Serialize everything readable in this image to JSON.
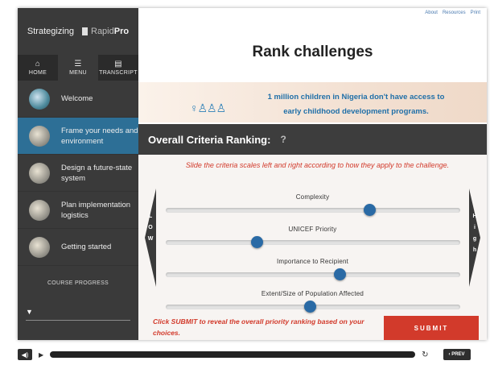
{
  "brand": {
    "text": "Strategizing",
    "rapid": "Rapid",
    "pro": "Pro"
  },
  "nav": [
    {
      "icon": "home-icon",
      "glyph": "⌂",
      "label": "HOME"
    },
    {
      "icon": "menu-icon",
      "glyph": "☰",
      "label": "MENU"
    },
    {
      "icon": "transcript-icon",
      "glyph": "▤",
      "label": "TRANSCRIPT"
    }
  ],
  "menu": [
    {
      "label": "Welcome",
      "active": false
    },
    {
      "label": "Frame your needs and environment",
      "active": true
    },
    {
      "label": "Design a future-state system",
      "active": false
    },
    {
      "label": "Plan implementation logistics",
      "active": false
    },
    {
      "label": "Getting started",
      "active": false
    }
  ],
  "course_progress": {
    "label": "COURSE PROGRESS",
    "glyph": "▼"
  },
  "toplinks": [
    "About",
    "Resources",
    "Print"
  ],
  "page_title": "Rank challenges",
  "banner": {
    "line1": "1 million children in Nigeria don't have access to",
    "line2": "early childhood development programs."
  },
  "section": {
    "title": "Overall Criteria Ranking:",
    "help": "?"
  },
  "instruction": "Slide the criteria scales left and right according to how they apply to the challenge.",
  "criteria": [
    {
      "label": "Complexity",
      "value": 0.69
    },
    {
      "label": "UNICEF Priority",
      "value": 0.31
    },
    {
      "label": "Importance to Recipient",
      "value": 0.59
    },
    {
      "label": "Extent/Size of Population Affected",
      "value": 0.49
    }
  ],
  "scale": {
    "low": "LOW",
    "high": "High"
  },
  "submit": {
    "hint": "Click SUBMIT to reveal the overall priority ranking based on your choices.",
    "button": "SUBMIT"
  },
  "player": {
    "reload": "↻",
    "prev": "PREV",
    "prev_glyph": "‹"
  },
  "colors": {
    "accent_blue": "#2d6f96",
    "submit_red": "#d23a2b",
    "sidebar": "#3a3a3a"
  }
}
